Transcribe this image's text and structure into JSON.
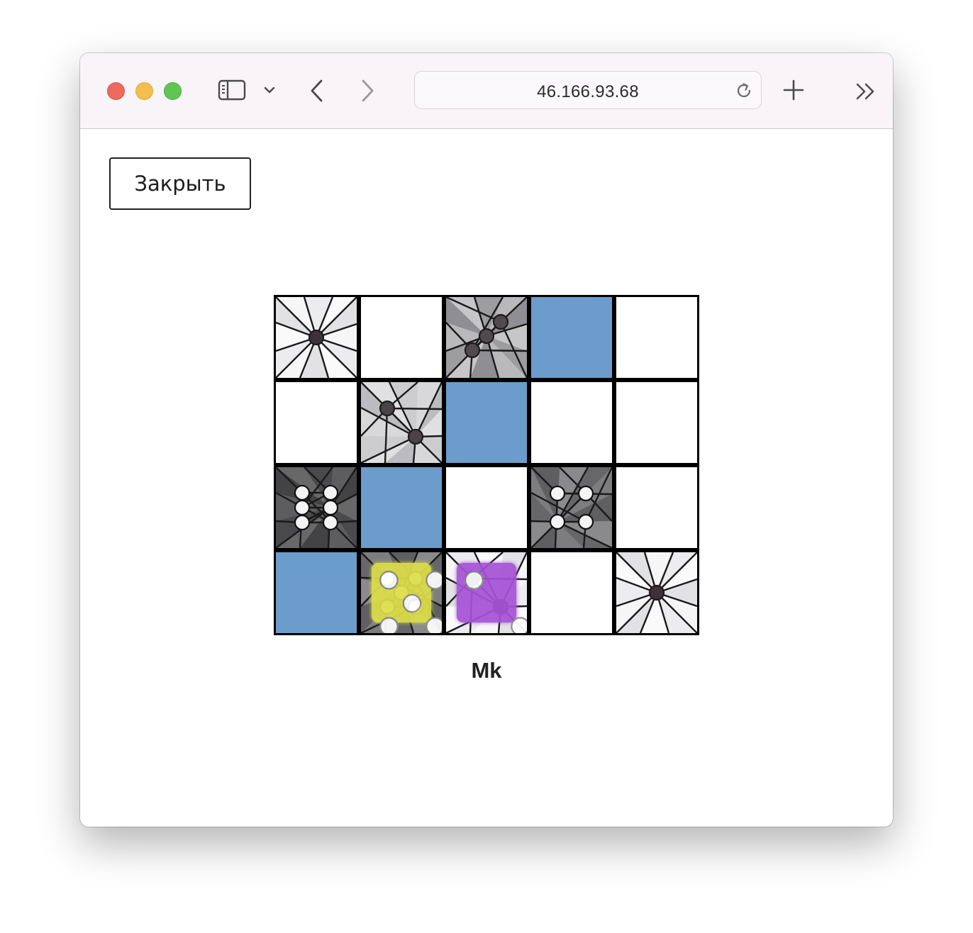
{
  "browser": {
    "url": "46.166.93.68",
    "icons": [
      "sidebar-icon",
      "chevron-down-icon",
      "back-icon",
      "forward-icon",
      "reload-icon",
      "new-tab-icon",
      "more-icon"
    ]
  },
  "page": {
    "close_label": "Закрыть",
    "player_name": "Mk"
  },
  "board": {
    "colors": {
      "blue": "#6b9ccc",
      "yellow": "#dede4a",
      "purple": "#a653d6"
    },
    "rows": [
      [
        {
          "type": "shade",
          "value": 1,
          "shade": "light"
        },
        {
          "type": "empty"
        },
        {
          "type": "shade",
          "value": 3,
          "shade": "mid"
        },
        {
          "type": "color",
          "color": "blue"
        },
        {
          "type": "empty"
        }
      ],
      [
        {
          "type": "empty"
        },
        {
          "type": "shade",
          "value": 2,
          "shade": "light-mid"
        },
        {
          "type": "color",
          "color": "blue"
        },
        {
          "type": "empty"
        },
        {
          "type": "empty"
        }
      ],
      [
        {
          "type": "shade",
          "value": 6,
          "shade": "dark"
        },
        {
          "type": "color",
          "color": "blue"
        },
        {
          "type": "empty"
        },
        {
          "type": "shade",
          "value": 4,
          "shade": "dark-mid"
        },
        {
          "type": "empty"
        }
      ],
      [
        {
          "type": "color",
          "color": "blue"
        },
        {
          "type": "shade",
          "value": 5,
          "shade": "dark-mid",
          "die": {
            "color": "yellow",
            "value": 5
          }
        },
        {
          "type": "shade",
          "value": 2,
          "shade": "light",
          "die": {
            "color": "purple",
            "value": 2
          }
        },
        {
          "type": "empty"
        },
        {
          "type": "shade",
          "value": 1,
          "shade": "light"
        }
      ]
    ]
  }
}
